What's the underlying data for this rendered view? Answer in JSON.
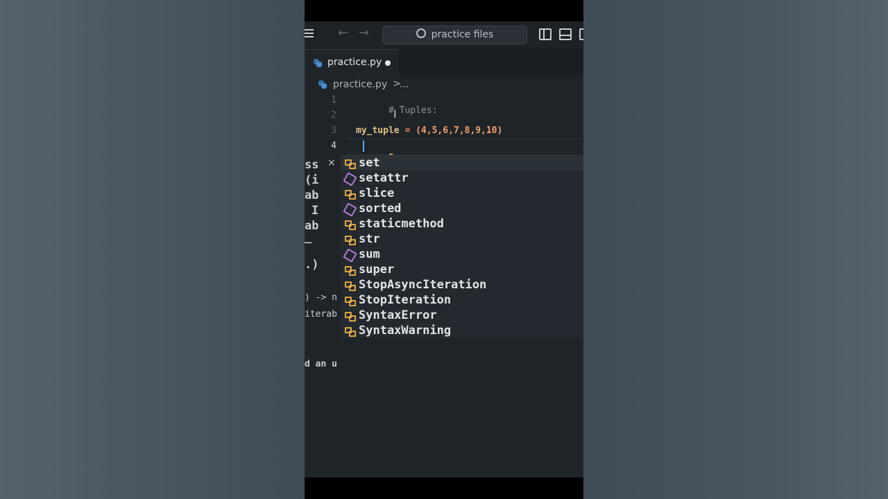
{
  "search": {
    "label": "practice files"
  },
  "tab": {
    "label": "practice.py"
  },
  "breadcrumb": {
    "file": "practice.py",
    "separator": ">",
    "more": "..."
  },
  "editor": {
    "line_numbers": [
      "1",
      "2",
      "3",
      "4"
    ],
    "lines": {
      "l1_comment": "# Tuples:",
      "l3_ident": "my_tuple",
      "l3_eq": " = ",
      "l3_value": "(4,5,6,7,8,9,10)",
      "l4_text": "s"
    }
  },
  "hover_panel": {
    "fragments": [
      "ss",
      "(i",
      "ab",
      "I",
      "ab",
      "_",
      ".)",
      ") -> n",
      "iterab"
    ],
    "close": "×"
  },
  "suggestions": [
    {
      "label": "set",
      "kind": "class"
    },
    {
      "label": "setattr",
      "kind": "function"
    },
    {
      "label": "slice",
      "kind": "class"
    },
    {
      "label": "sorted",
      "kind": "function"
    },
    {
      "label": "staticmethod",
      "kind": "class"
    },
    {
      "label": "str",
      "kind": "class"
    },
    {
      "label": "sum",
      "kind": "function"
    },
    {
      "label": "super",
      "kind": "class"
    },
    {
      "label": "StopAsyncIteration",
      "kind": "class"
    },
    {
      "label": "StopIteration",
      "kind": "class"
    },
    {
      "label": "SyntaxError",
      "kind": "class"
    },
    {
      "label": "SyntaxWarning",
      "kind": "class"
    }
  ],
  "trailing_text": "d an u",
  "colors": {
    "accent": "#5ca8ff",
    "class_icon": "#e2a843",
    "function_icon": "#b57ad6"
  }
}
